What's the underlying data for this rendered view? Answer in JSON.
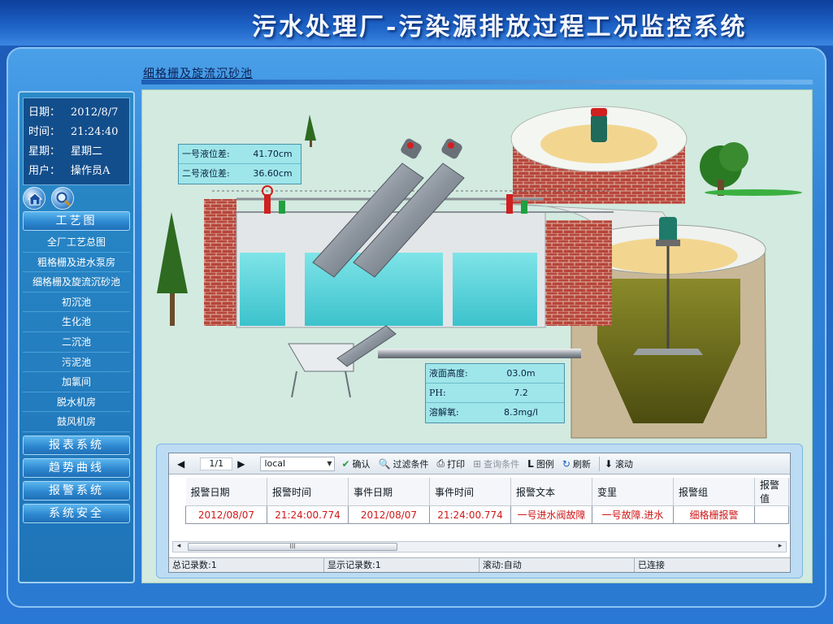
{
  "app": {
    "title": "污水处理厂-污染源排放过程工况监控系统",
    "page_heading": "细格栅及旋流沉砂池"
  },
  "info": {
    "date_label": "日期：",
    "date_value": "2012/8/7",
    "time_label": "时间：",
    "time_value": "21:24:40",
    "weekday_label": "星期：",
    "weekday_value": "星期二",
    "user_label": "用户：",
    "user_value": "操作员A"
  },
  "icons": [
    "home-icon",
    "magnifier-icon"
  ],
  "nav": {
    "process_header": "工艺图",
    "items": [
      {
        "label": "全厂工艺总图"
      },
      {
        "label": "粗格栅及进水泵房"
      },
      {
        "label": "细格栅及旋流沉砂池"
      },
      {
        "label": "初沉池"
      },
      {
        "label": "生化池"
      },
      {
        "label": "二沉池"
      },
      {
        "label": "污泥池"
      },
      {
        "label": "加氯间"
      },
      {
        "label": "脱水机房"
      },
      {
        "label": "鼓风机房"
      }
    ],
    "report": "报表系统",
    "trend": "趋势曲线",
    "alarm": "报警系统",
    "security": "系统安全"
  },
  "readouts_level": [
    {
      "label": "一号液位差:",
      "value": "41.70cm"
    },
    {
      "label": "二号液位差:",
      "value": "36.60cm"
    }
  ],
  "readouts_tank": [
    {
      "label": "液面高度:",
      "value": "03.0m"
    },
    {
      "label": "PH:",
      "value": "7.2"
    },
    {
      "label": "溶解氧:",
      "value": "8.3mg/l"
    }
  ],
  "alarm": {
    "page": "1/1",
    "source": "local",
    "confirm": "确认",
    "filter": "过滤条件",
    "print": "打印",
    "query": "查询条件",
    "legend": "图例",
    "legend_glyph": "L",
    "refresh": "刷新",
    "scroll": "滚动",
    "columns": [
      "报警日期",
      "报警时间",
      "事件日期",
      "事件时间",
      "报警文本",
      "变里",
      "报警组",
      "报警值"
    ],
    "rows": [
      [
        "2012/08/07",
        "21:24:00.774",
        "2012/08/07",
        "21:24:00.774",
        "一号进水阀故障",
        "一号故障.进水",
        "细格栅报警",
        ""
      ]
    ],
    "status": {
      "total": "总记录数:1",
      "shown": "显示记录数:1",
      "scroll": "滚动:自动",
      "conn": "已连接"
    },
    "scroll_thumb": "III"
  },
  "colors": {
    "alarm_text": "#d01818",
    "water": "#4fd0d8",
    "brick": "#c0483a",
    "sludge": "#6a6a18"
  }
}
